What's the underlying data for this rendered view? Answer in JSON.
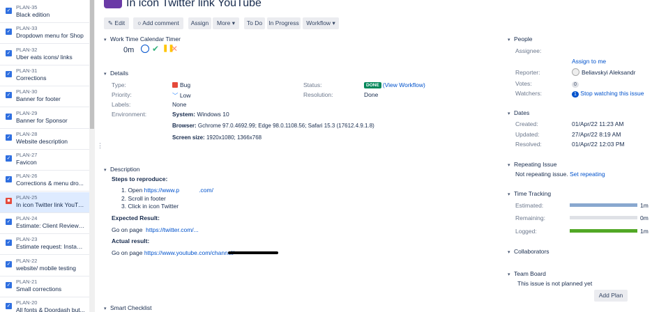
{
  "sidebar": {
    "items": [
      {
        "key": "PLAN-35",
        "summary": "Black edition",
        "type": "story"
      },
      {
        "key": "PLAN-33",
        "summary": "Dropdown menu for Shop",
        "type": "story"
      },
      {
        "key": "PLAN-32",
        "summary": "Uber eats icons/ links",
        "type": "story"
      },
      {
        "key": "PLAN-31",
        "summary": "Corrections",
        "type": "story"
      },
      {
        "key": "PLAN-30",
        "summary": "Banner for footer",
        "type": "story"
      },
      {
        "key": "PLAN-29",
        "summary": "Banner for Sponsor",
        "type": "story"
      },
      {
        "key": "PLAN-28",
        "summary": "Website description",
        "type": "story"
      },
      {
        "key": "PLAN-27",
        "summary": "Favicon",
        "type": "story"
      },
      {
        "key": "PLAN-26",
        "summary": "Corrections & menu dro...",
        "type": "story"
      },
      {
        "key": "PLAN-25",
        "summary": "In icon Twitter link YouTu...",
        "type": "bug"
      },
      {
        "key": "PLAN-24",
        "summary": "Estimate: Client Reviews ...",
        "type": "story"
      },
      {
        "key": "PLAN-23",
        "summary": "Estimate request: Instagr...",
        "type": "story"
      },
      {
        "key": "PLAN-22",
        "summary": "website/ mobile testing",
        "type": "story"
      },
      {
        "key": "PLAN-21",
        "summary": "Small corrections",
        "type": "story"
      },
      {
        "key": "PLAN-20",
        "summary": "All fonts & Doordash but...",
        "type": "story"
      }
    ]
  },
  "issue": {
    "title": "In icon Twitter link YouTube"
  },
  "toolbar": {
    "edit": "Edit",
    "add_comment": "Add comment",
    "assign": "Assign",
    "more": "More",
    "to_do": "To Do",
    "in_progress": "In Progress",
    "workflow": "Workflow"
  },
  "timer": {
    "heading": "Work Time Calendar Timer",
    "value": "0m"
  },
  "details": {
    "heading": "Details",
    "type_label": "Type:",
    "type_value": "Bug",
    "priority_label": "Priority:",
    "priority_value": "Low",
    "labels_label": "Labels:",
    "labels_value": "None",
    "environment_label": "Environment:",
    "status_label": "Status:",
    "status_value": "DONE",
    "view_workflow": "(View Workflow)",
    "resolution_label": "Resolution:",
    "resolution_value": "Done",
    "env_system_label": "System:",
    "env_system_value": "Windows 10",
    "env_browser_label": "Browser:",
    "env_browser_value": "Gchrome 97.0.4692.99; Edge 98.0.1108.56; Safari 15.3 (17612.4.9.1.8)",
    "env_screen_label": "Screen size:",
    "env_screen_value": "1920x1080; 1366x768"
  },
  "description": {
    "heading": "Description",
    "steps_heading": "Steps to reproduce:",
    "step1_prefix": "1. Open ",
    "step1_link_a": "https://www.p",
    "step1_link_b": ".com/",
    "step2": "2. Scroll in footer",
    "step3": "3. Click in icon Twitter",
    "expected_heading": "Expected Result:",
    "expected_prefix": "Go on page",
    "expected_link": "https://twitter.com/...",
    "actual_heading": "Actual result:",
    "actual_prefix": "Go on page",
    "actual_link": "https://www.youtube.com/channel/"
  },
  "smart_checklist": {
    "heading": "Smart Checklist"
  },
  "people": {
    "heading": "People",
    "assignee_label": "Assignee:",
    "assign_to_me": "Assign to me",
    "reporter_label": "Reporter:",
    "reporter_value": "Beliavskyi Aleksandr",
    "votes_label": "Votes:",
    "votes_value": "0",
    "watchers_label": "Watchers:",
    "watchers_value": "1",
    "stop_watching": "Stop watching this issue"
  },
  "dates": {
    "heading": "Dates",
    "created_label": "Created:",
    "created_value": "01/Apr/22 11:23 AM",
    "updated_label": "Updated:",
    "updated_value": "27/Apr/22 8:19 AM",
    "resolved_label": "Resolved:",
    "resolved_value": "01/Apr/22 12:03 PM"
  },
  "repeating": {
    "heading": "Repeating Issue",
    "text": "Not repeating issue.",
    "link": "Set repeating"
  },
  "time_tracking": {
    "heading": "Time Tracking",
    "estimated_label": "Estimated:",
    "estimated_value": "1m",
    "estimated_fill": 1.0,
    "remaining_label": "Remaining:",
    "remaining_value": "0m",
    "remaining_fill": 0.0,
    "logged_label": "Logged:",
    "logged_value": "1m",
    "logged_fill": 1.0
  },
  "collaborators": {
    "heading": "Collaborators"
  },
  "team_board": {
    "heading": "Team Board",
    "text": "This issue is not planned yet",
    "add_plan": "Add Plan"
  },
  "colors": {
    "accent": "#0052cc",
    "done": "#00875a",
    "bug": "#e5493a",
    "estimate_bar": "#89a8cf",
    "logged_bar": "#51a825"
  }
}
